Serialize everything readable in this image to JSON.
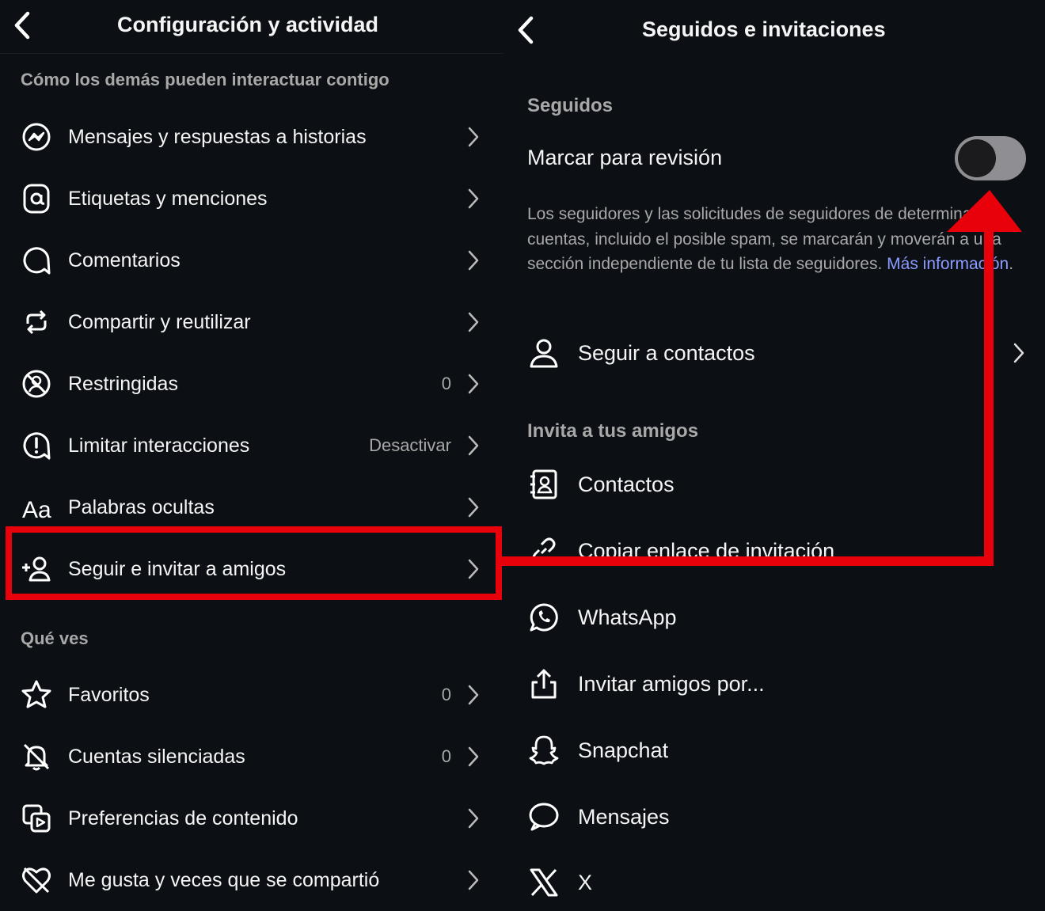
{
  "left": {
    "title": "Configuración y actividad",
    "section_interact": "Cómo los demás pueden interactuar contigo",
    "items": [
      {
        "label": "Mensajes y respuestas a historias",
        "value": "",
        "icon": "messenger-icon"
      },
      {
        "label": "Etiquetas y menciones",
        "value": "",
        "icon": "at-sign-icon"
      },
      {
        "label": "Comentarios",
        "value": "",
        "icon": "comment-icon"
      },
      {
        "label": "Compartir y reutilizar",
        "value": "",
        "icon": "repost-icon"
      },
      {
        "label": "Restringidas",
        "value": "0",
        "icon": "restricted-icon"
      },
      {
        "label": "Limitar interacciones",
        "value": "Desactivar",
        "icon": "alert-circle-icon"
      },
      {
        "label": "Palabras ocultas",
        "value": "",
        "icon": "text-aa-icon"
      },
      {
        "label": "Seguir e invitar a amigos",
        "value": "",
        "icon": "add-person-icon"
      }
    ],
    "section_see": "Qué ves",
    "items2": [
      {
        "label": "Favoritos",
        "value": "0",
        "icon": "star-icon"
      },
      {
        "label": "Cuentas silenciadas",
        "value": "0",
        "icon": "bell-off-icon"
      },
      {
        "label": "Preferencias de contenido",
        "value": "",
        "icon": "content-prefs-icon"
      },
      {
        "label": "Me gusta y veces que se compartió",
        "value": "",
        "icon": "heart-off-icon"
      }
    ]
  },
  "right": {
    "title": "Seguidos e invitaciones",
    "section_follow": "Seguidos",
    "toggle_label": "Marcar para revisión",
    "toggle_on": false,
    "desc_text": "Los seguidores y las solicitudes de seguidores de determinadas cuentas, incluido el posible spam, se marcarán y moverán a una sección independiente de tu lista de seguidores. ",
    "desc_link": "Más información",
    "desc_end": ".",
    "follow_contacts": "Seguir a contactos",
    "section_invite": "Invita a tus amigos",
    "invite_items": [
      {
        "label": "Contactos",
        "icon": "contacts-book-icon"
      },
      {
        "label": "Copiar enlace de invitación",
        "icon": "link-icon"
      },
      {
        "label": "WhatsApp",
        "icon": "whatsapp-icon"
      },
      {
        "label": "Invitar amigos por...",
        "icon": "share-icon"
      },
      {
        "label": "Snapchat",
        "icon": "snapchat-icon"
      },
      {
        "label": "Mensajes",
        "icon": "message-bubble-icon"
      },
      {
        "label": "X",
        "icon": "x-logo-icon"
      }
    ]
  },
  "colors": {
    "background": "#0c1014",
    "highlight": "#e8000b",
    "link": "#8b9cff",
    "muted": "#a8a8a8"
  }
}
